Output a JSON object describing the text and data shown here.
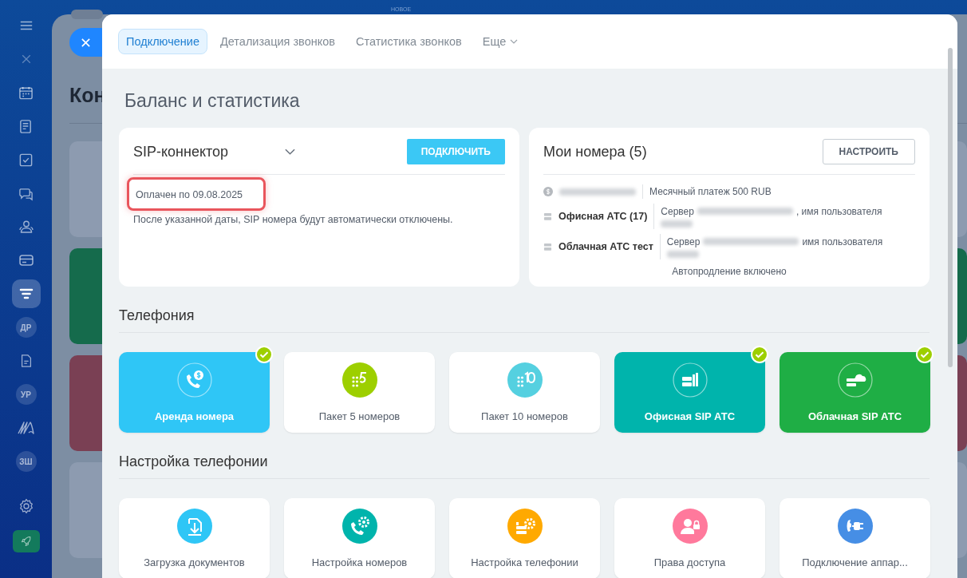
{
  "sidebar": {
    "items": [
      {
        "kind": "menu",
        "selected": false
      },
      {
        "kind": "close",
        "selected": false
      },
      {
        "kind": "calendar",
        "selected": false
      },
      {
        "kind": "news",
        "selected": false
      },
      {
        "kind": "tasks",
        "selected": false
      },
      {
        "kind": "chat",
        "selected": false
      },
      {
        "kind": "contacts",
        "selected": false
      },
      {
        "kind": "card",
        "selected": false
      },
      {
        "kind": "funnel",
        "selected": true
      },
      {
        "kind": "initials",
        "text": "ДР",
        "selected": false
      },
      {
        "kind": "document",
        "selected": false
      },
      {
        "kind": "initials",
        "text": "УР",
        "selected": false
      },
      {
        "kind": "squiggle",
        "selected": false
      },
      {
        "kind": "initials",
        "text": "ЗШ",
        "selected": false
      },
      {
        "kind": "gear",
        "selected": false
      },
      {
        "kind": "rocket",
        "selected": false
      }
    ]
  },
  "top_bar": {
    "new_label": "НОВОЕ"
  },
  "background_page": {
    "title": "Кон",
    "cards": [
      {
        "color": "#8d9bb0"
      },
      {
        "color": "#156b4c"
      },
      {
        "color": "#7a4054"
      },
      {
        "color": "#8d9bb0"
      }
    ]
  },
  "panel": {
    "tabs": [
      {
        "label": "Подключение",
        "selected": true
      },
      {
        "label": "Детализация звонков",
        "selected": false
      },
      {
        "label": "Статистика звонков",
        "selected": false
      },
      {
        "label": "Еще",
        "selected": false,
        "dropdown": true
      }
    ],
    "title": "Баланс и статистика",
    "sip_card": {
      "title": "SIP-коннектор",
      "button": "ПОДКЛЮЧИТЬ",
      "paid_until": "Оплачен по 09.08.2025",
      "note": "После указанной даты, SIP номера будут автоматически отключены."
    },
    "numbers_card": {
      "title": "Мои номера (5)",
      "button": "НАСТРОИТЬ",
      "rows": [
        {
          "kind": "payment",
          "detail": "Месячный платеж 500 RUB"
        },
        {
          "kind": "pbx",
          "name": "Офисная АТС (17)",
          "server_label": "Сервер",
          "user_label": ", имя пользователя"
        },
        {
          "kind": "pbx",
          "name": "Облачная АТС тест",
          "server_label": "Сервер",
          "user_label": "имя пользователя"
        }
      ],
      "footer": "Автопродление включено"
    },
    "sections": [
      {
        "title": "Телефония",
        "tiles": [
          {
            "label": "Аренда номера",
            "kind": "phone-dollar",
            "filled": true,
            "color": "#2fc6f6",
            "checked": true
          },
          {
            "label": "Пакет 5 номеров",
            "kind": "pack5",
            "filled": false,
            "color": "#9dcf00",
            "checked": false
          },
          {
            "label": "Пакет 10 номеров",
            "kind": "pack10",
            "filled": false,
            "color": "#55d0e0",
            "checked": false
          },
          {
            "label": "Офисная SIP АТС",
            "kind": "office",
            "filled": true,
            "color": "#00b4ac",
            "checked": true
          },
          {
            "label": "Облачная SIP АТС",
            "kind": "cloud",
            "filled": true,
            "color": "#1fae45",
            "checked": true
          }
        ]
      },
      {
        "title": "Настройка телефонии",
        "tiles": [
          {
            "label": "Загрузка документов",
            "kind": "download",
            "filled": false,
            "color": "#2fc6f6",
            "checked": false
          },
          {
            "label": "Настройка номеров",
            "kind": "phone-gear",
            "filled": false,
            "color": "#00b4ac",
            "checked": false
          },
          {
            "label": "Настройка телефонии",
            "kind": "server-gear",
            "filled": false,
            "color": "#ffa900",
            "checked": false
          },
          {
            "label": "Права доступа",
            "kind": "user-lock",
            "filled": false,
            "color": "#ff799c",
            "checked": false
          },
          {
            "label": "Подключение аппар...",
            "kind": "plug",
            "filled": false,
            "color": "#468ee5",
            "checked": false
          }
        ]
      }
    ]
  }
}
